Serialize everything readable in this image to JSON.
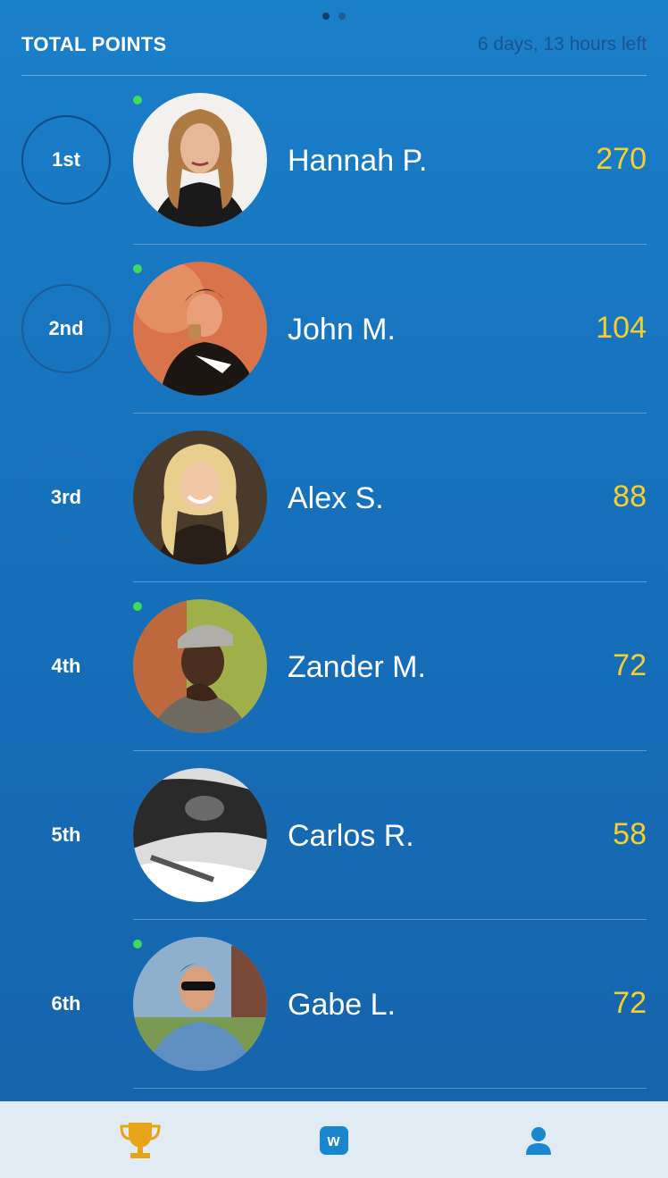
{
  "pager": {
    "pages": 2,
    "active": 1
  },
  "header": {
    "title": "TOTAL POINTS",
    "timer": "6 days, 13 hours left"
  },
  "leaderboard": [
    {
      "rank": "1st",
      "name": "Hannah P.",
      "points": "270",
      "online": true
    },
    {
      "rank": "2nd",
      "name": "John M.",
      "points": "104",
      "online": true
    },
    {
      "rank": "3rd",
      "name": "Alex S.",
      "points": "88",
      "online": false
    },
    {
      "rank": "4th",
      "name": "Zander M.",
      "points": "72",
      "online": true
    },
    {
      "rank": "5th",
      "name": "Carlos R.",
      "points": "58",
      "online": false
    },
    {
      "rank": "6th",
      "name": "Gabe L.",
      "points": "72",
      "online": true
    }
  ],
  "tabbar": {
    "tabs": [
      {
        "icon": "trophy-icon",
        "active": true
      },
      {
        "icon": "w-logo-icon",
        "label": "w"
      },
      {
        "icon": "user-icon"
      }
    ]
  },
  "colors": {
    "background": "#1670bb",
    "points": "#f7cf2d",
    "online": "#3ddc5a",
    "tabbar": "#e1ebf4",
    "trophy": "#e8a416",
    "tab-icon": "#1b86d0"
  }
}
